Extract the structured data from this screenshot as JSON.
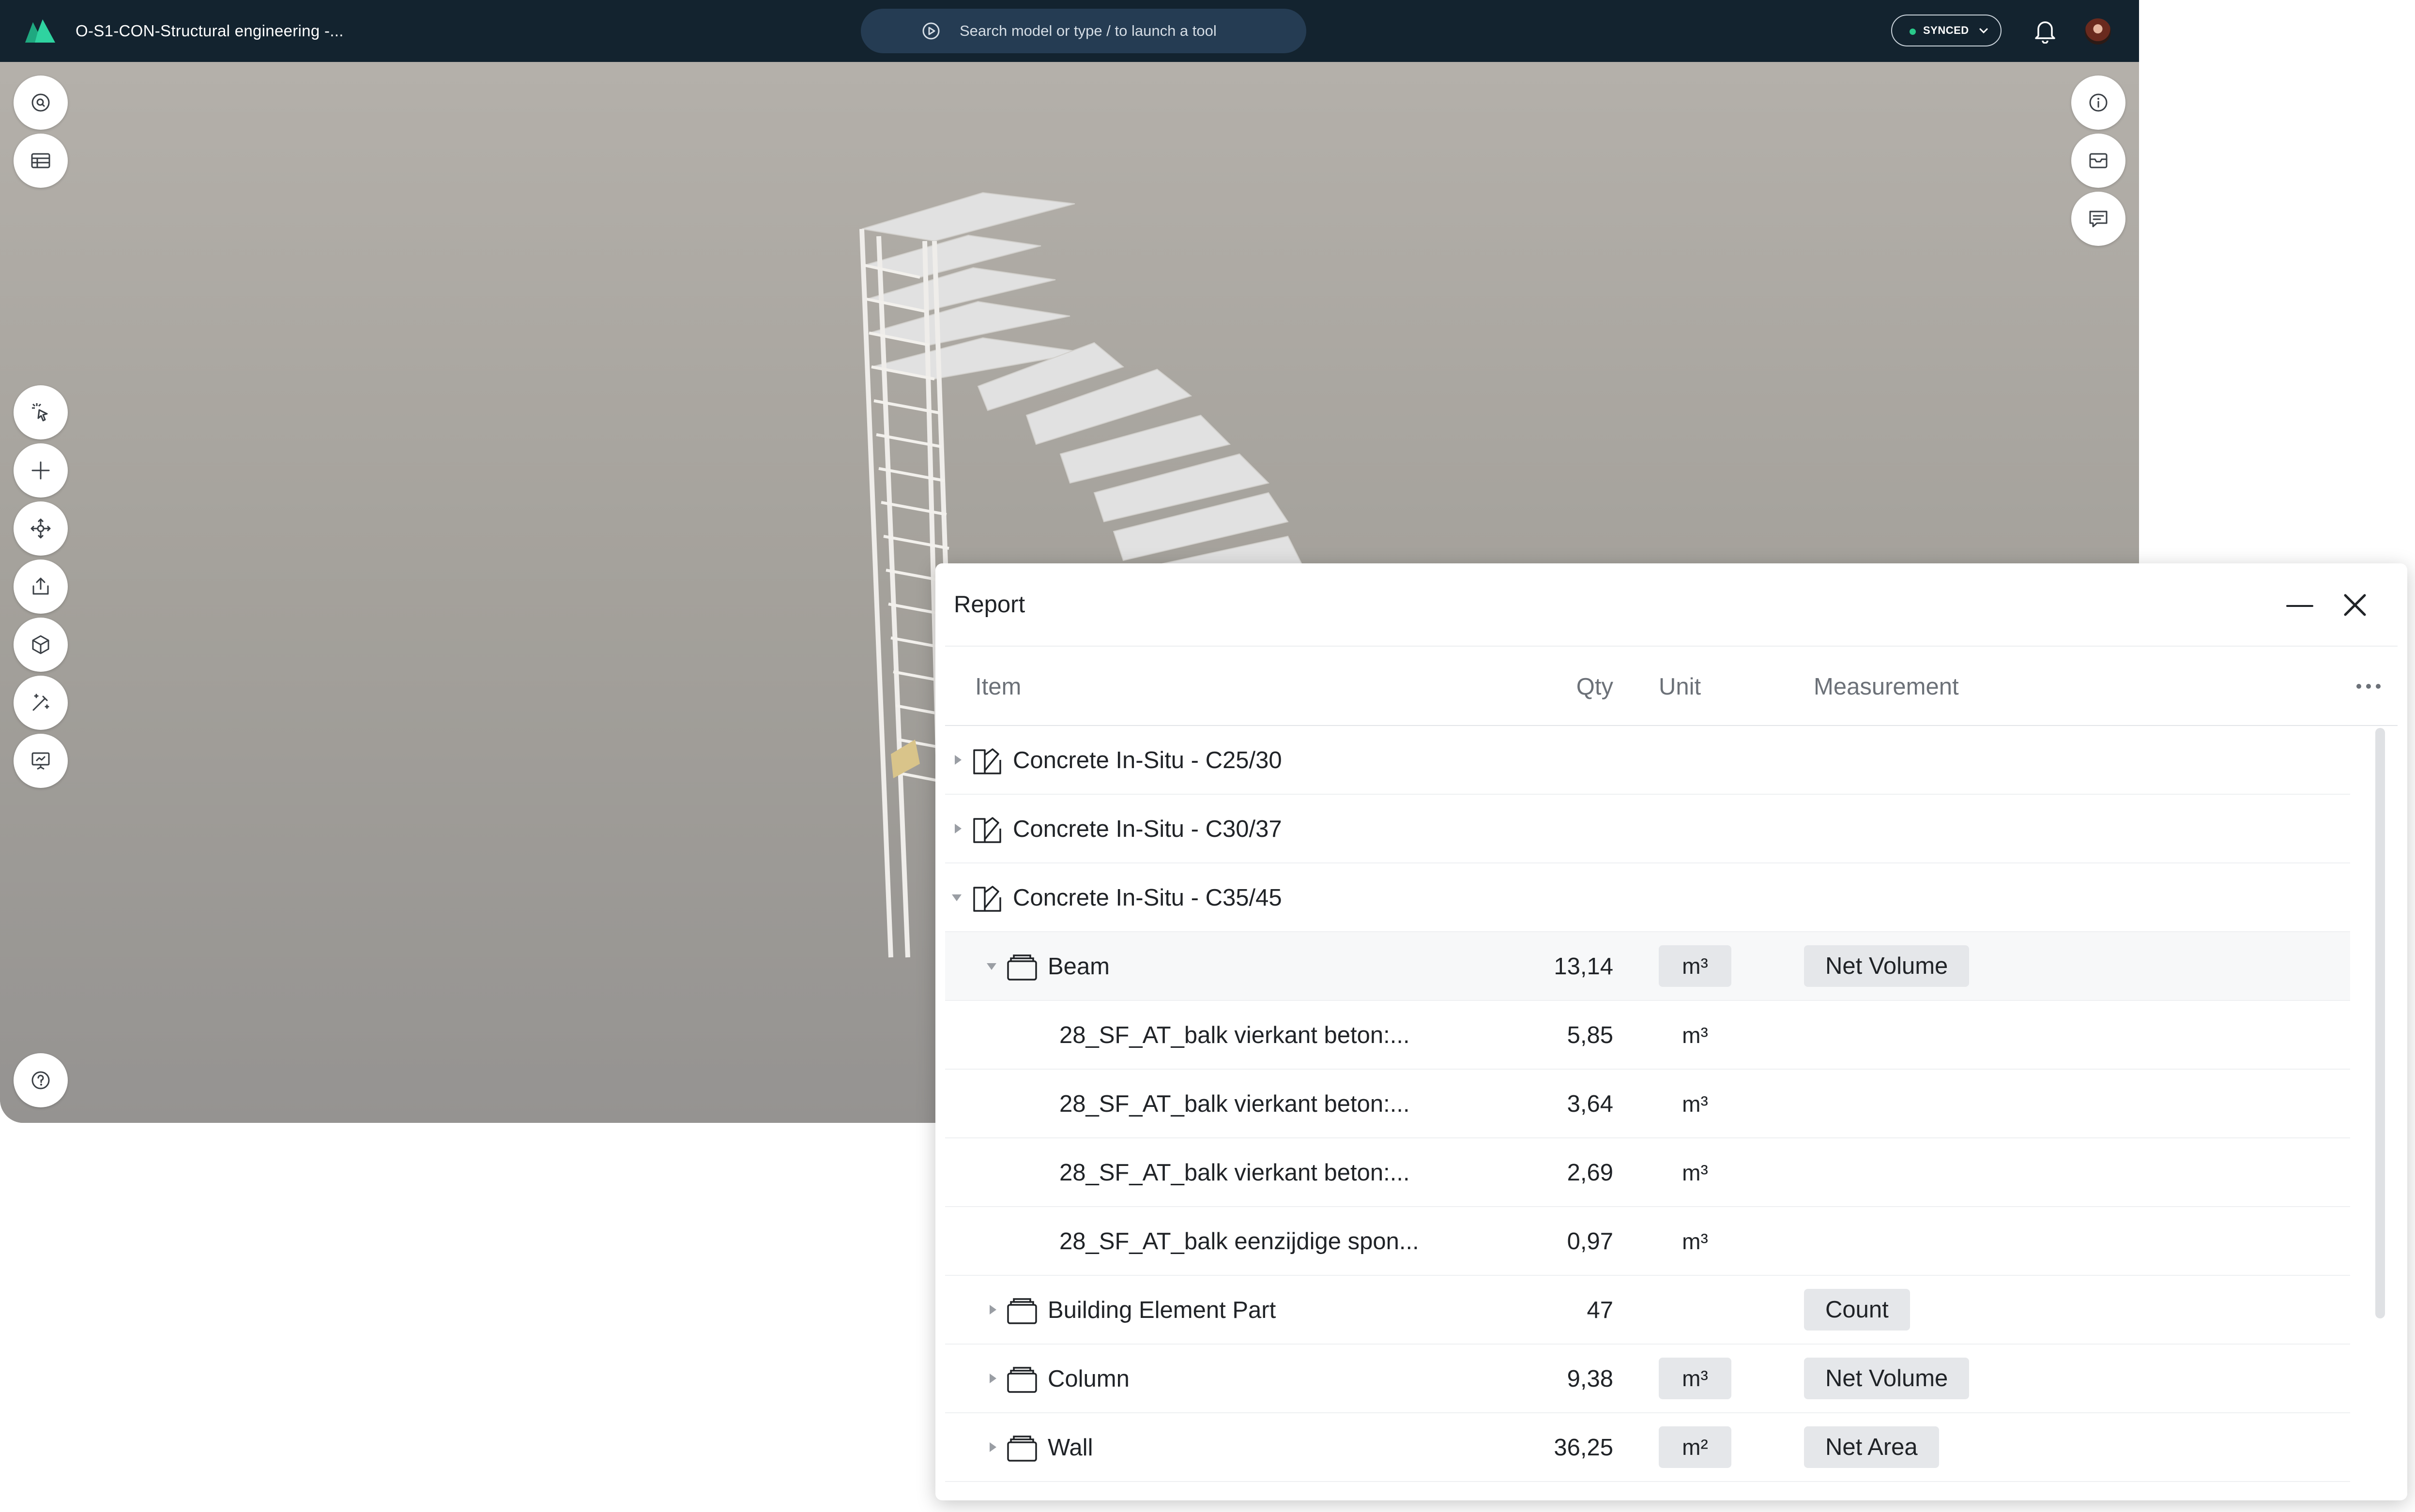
{
  "header": {
    "title": "O-S1-CON-Structural engineering -...",
    "search_placeholder": "Search model or type / to launch a tool",
    "sync_status": "SYNCED"
  },
  "colors": {
    "topbar": "#13232f",
    "accent": "#29c98a",
    "pill": "#e5e7ea"
  },
  "left_tools": [
    "search-icon",
    "table-icon",
    "select-icon",
    "add-icon",
    "move-icon",
    "share-icon",
    "model-icon",
    "magic-wand-icon",
    "presentation-icon",
    "help-icon"
  ],
  "right_tools": [
    "info-icon",
    "inbox-icon",
    "comment-icon"
  ],
  "report": {
    "title": "Report",
    "columns": {
      "item": "Item",
      "qty": "Qty",
      "unit": "Unit",
      "measurement": "Measurement"
    },
    "rows": [
      {
        "label": "Concrete In-Situ - C25/30",
        "qty": "",
        "unit": "",
        "measurement": "",
        "expanded": false
      },
      {
        "label": "Concrete In-Situ - C30/37",
        "qty": "",
        "unit": "",
        "measurement": "",
        "expanded": false
      },
      {
        "label": "Concrete In-Situ - C35/45",
        "qty": "",
        "unit": "",
        "measurement": "",
        "expanded": true
      },
      {
        "label": "Beam",
        "qty": "13,14",
        "unit": "m³",
        "measurement": "Net Volume",
        "expanded": true
      },
      {
        "label": "28_SF_AT_balk vierkant beton:...",
        "qty": "5,85",
        "unit": "m³",
        "measurement": ""
      },
      {
        "label": "28_SF_AT_balk vierkant beton:...",
        "qty": "3,64",
        "unit": "m³",
        "measurement": ""
      },
      {
        "label": "28_SF_AT_balk vierkant beton:...",
        "qty": "2,69",
        "unit": "m³",
        "measurement": ""
      },
      {
        "label": "28_SF_AT_balk eenzijdige spon...",
        "qty": "0,97",
        "unit": "m³",
        "measurement": ""
      },
      {
        "label": "Building Element Part",
        "qty": "47",
        "unit": "",
        "measurement": "Count",
        "expanded": false
      },
      {
        "label": "Column",
        "qty": "9,38",
        "unit": "m³",
        "measurement": "Net Volume",
        "expanded": false
      },
      {
        "label": "Wall",
        "qty": "36,25",
        "unit": "m²",
        "measurement": "Net Area",
        "expanded": false
      }
    ]
  }
}
